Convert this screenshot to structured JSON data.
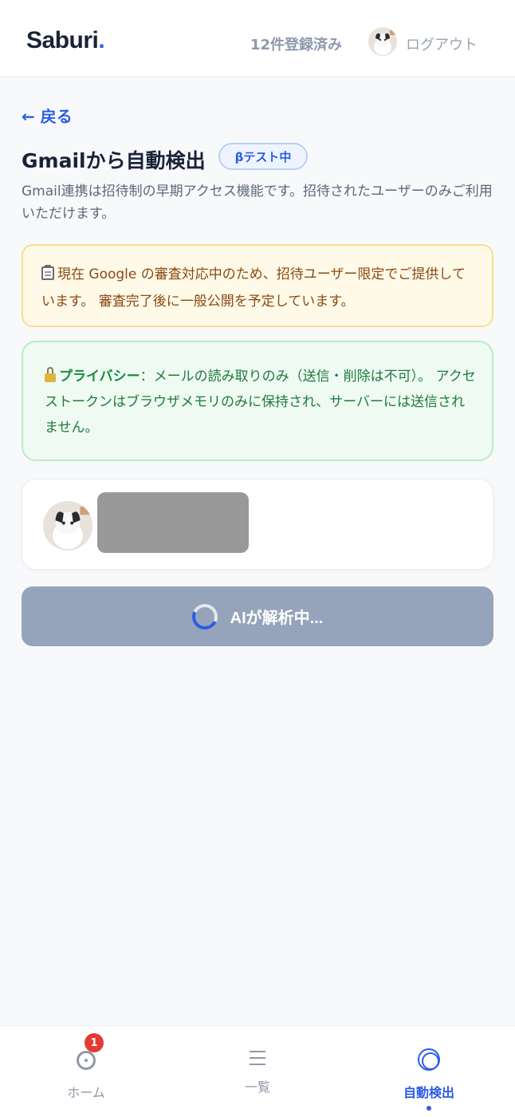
{
  "header": {
    "logo": "Saburi",
    "logo_dot": ".",
    "registered_count": "12件登録済み",
    "logout_label": "ログアウト"
  },
  "main": {
    "back_label": "← 戻る",
    "title": "Gmailから自動検出",
    "beta_badge": "βテスト中",
    "description": "Gmail連携は招待制の早期アクセス機能です。招待されたユーザーのみご利用いただけます。",
    "notice": {
      "icon": "clipboard-icon",
      "text": "現在 Google の審査対応中のため、招待ユーザー限定でご提供しています。 審査完了後に一般公開を予定しています。"
    },
    "privacy": {
      "icon": "lock-icon",
      "label": "プライバシー",
      "text": "：メールの読み取りのみ（送信・削除は不可）。 アクセストークンはブラウザメモリのみに保持され、サーバーには送信されません。"
    },
    "analyze_button": "AIが解析中..."
  },
  "bottom_nav": {
    "items": [
      {
        "label": "ホーム",
        "icon": "home-circle-icon",
        "badge": "1"
      },
      {
        "label": "一覧",
        "icon": "list-icon"
      },
      {
        "label": "自動検出",
        "icon": "target-icon",
        "active": true
      }
    ]
  },
  "colors": {
    "accent": "#2b5ce6",
    "notice_bg": "#fff9e8",
    "privacy_bg": "#eefaf2",
    "button_disabled": "#95a4bb",
    "badge_red": "#e53935"
  }
}
